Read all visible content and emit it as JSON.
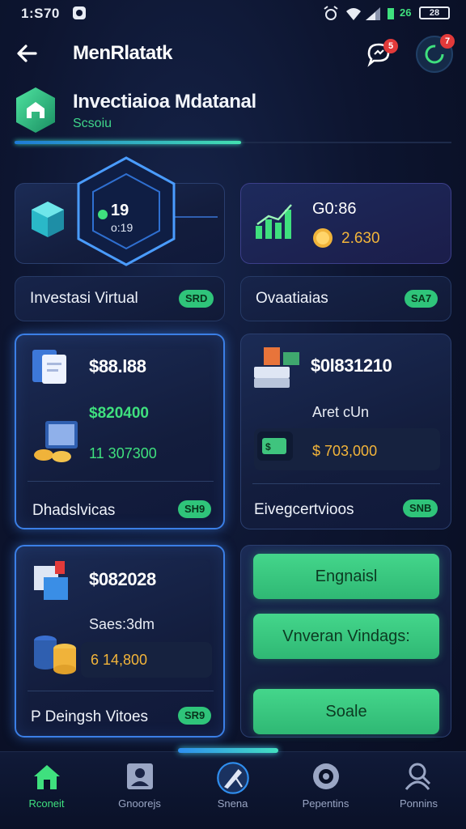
{
  "status_bar": {
    "time": "1:S70",
    "network": "26",
    "battery": "28"
  },
  "top_bar": {
    "title": "MenRlatatk",
    "chat_badge": "5",
    "profile_badge": "7"
  },
  "header": {
    "name": "Invectiaioa Mdatanal",
    "subtitle": "Scsoiu"
  },
  "hero_cards": [
    {
      "chip_top": "19",
      "chip_bottom": "o:19"
    },
    {
      "title": "G0:86",
      "value": "2.630"
    }
  ],
  "label_bars": [
    {
      "label": "Investasi Virtual",
      "pill": "SRD"
    },
    {
      "label": "Ovaatiaias",
      "pill": "SA7"
    }
  ],
  "cards": [
    {
      "amount": "$88.l88",
      "green_amount": "$820400",
      "sub_amount": "11 307300",
      "label": "Dhadslvicas",
      "pill": "SH9"
    },
    {
      "amount": "$0l831210",
      "caption": "Aret cUn",
      "gold_amount": "$ 703,000",
      "label": "Eivegcertvioos",
      "pill": "SNB"
    },
    {
      "amount": "$082028",
      "caption": "Saes:3dm",
      "gold_amount": "6 14,800",
      "label": "P Deingsh Vitoes",
      "pill": "SR9"
    }
  ],
  "buttons": [
    "Engnaisl",
    "Vnveran Vindags:",
    "Soale"
  ],
  "bottom_nav": [
    {
      "label": "Rconeit",
      "icon": "home-icon",
      "active": true
    },
    {
      "label": "Gnoorejs",
      "icon": "user-card-icon",
      "active": false
    },
    {
      "label": "Snena",
      "icon": "compass-icon",
      "active": false
    },
    {
      "label": "Pepentins",
      "icon": "target-icon",
      "active": false
    },
    {
      "label": "Ponnins",
      "icon": "person-search-icon",
      "active": false
    }
  ],
  "colors": {
    "accent_green": "#3fe07e",
    "accent_blue": "#3b7fe6",
    "gold": "#f3b53a",
    "background": "#0d1530"
  }
}
